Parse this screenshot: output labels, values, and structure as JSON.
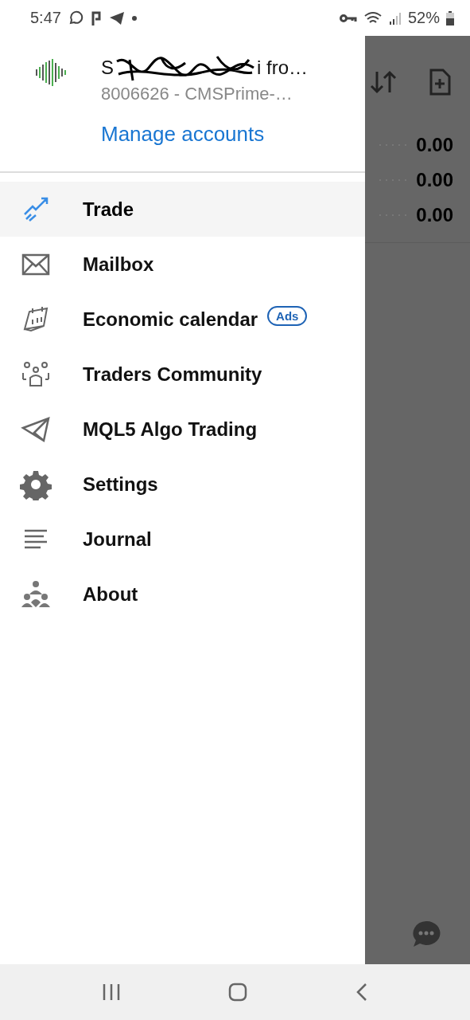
{
  "status_bar": {
    "time": "5:47",
    "battery": "52%"
  },
  "account": {
    "name_start": "S",
    "name_end": "i fro…",
    "server": "8006626 - CMSPrime-…",
    "manage": "Manage accounts"
  },
  "menu": [
    {
      "label": "Trade",
      "kind": "trade",
      "selected": true
    },
    {
      "label": "Mailbox",
      "kind": "mail",
      "selected": false
    },
    {
      "label": "Economic calendar",
      "kind": "calendar",
      "selected": false,
      "badge": "Ads"
    },
    {
      "label": "Traders Community",
      "kind": "community",
      "selected": false
    },
    {
      "label": "MQL5 Algo Trading",
      "kind": "plane",
      "selected": false
    },
    {
      "label": "Settings",
      "kind": "gear",
      "selected": false
    },
    {
      "label": "Journal",
      "kind": "journal",
      "selected": false
    },
    {
      "label": "About",
      "kind": "about",
      "selected": false
    }
  ],
  "background": {
    "values": [
      "0.00",
      "0.00",
      "0.00"
    ]
  }
}
